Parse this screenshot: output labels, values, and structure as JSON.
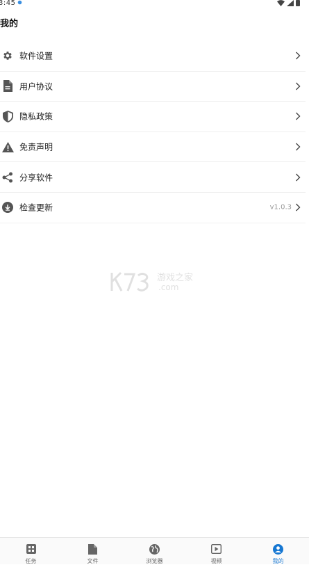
{
  "status_bar": {
    "time": "3:45"
  },
  "page": {
    "title": "我的"
  },
  "menu": {
    "items": [
      {
        "label": "软件设置",
        "icon": "gear-icon"
      },
      {
        "label": "用户协议",
        "icon": "document-icon"
      },
      {
        "label": "隐私政策",
        "icon": "shield-icon"
      },
      {
        "label": "免责声明",
        "icon": "warning-icon"
      },
      {
        "label": "分享软件",
        "icon": "share-icon"
      },
      {
        "label": "检查更新",
        "icon": "download-icon",
        "value": "v1.0.3"
      }
    ]
  },
  "watermark": {
    "text": "游戏之家",
    "sub": ".com"
  },
  "bottom_nav": {
    "items": [
      {
        "label": "任务",
        "icon": "grid-icon"
      },
      {
        "label": "文件",
        "icon": "file-icon"
      },
      {
        "label": "浏览器",
        "icon": "globe-icon"
      },
      {
        "label": "视频",
        "icon": "play-icon"
      },
      {
        "label": "我的",
        "icon": "person-icon",
        "active": true
      }
    ]
  },
  "colors": {
    "accent": "#1677d2",
    "icon": "#555555",
    "divider": "#eeeeee"
  }
}
